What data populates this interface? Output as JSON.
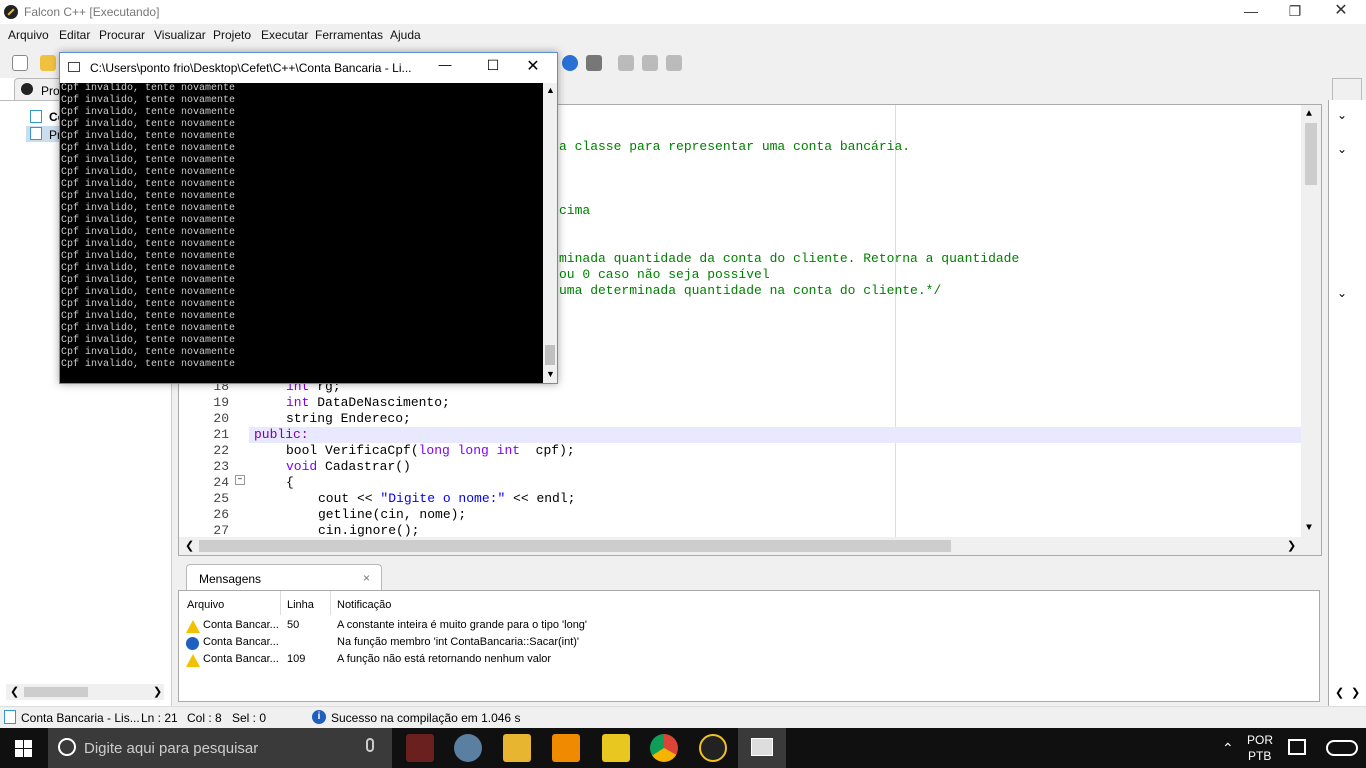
{
  "window": {
    "title": "Falcon C++ [Executando]"
  },
  "menu": [
    "Arquivo",
    "Editar",
    "Procurar",
    "Visualizar",
    "Projeto",
    "Executar",
    "Ferramentas",
    "Ajuda"
  ],
  "left_panel": {
    "tab_label": "Proj",
    "items": [
      "Co",
      "Pr"
    ]
  },
  "console": {
    "title": "C:\\Users\\ponto frio\\Desktop\\Cefet\\C++\\Conta Bancaria - Li...",
    "lines": [
      "Cpf invalido, tente novamente",
      "Cpf invalido, tente novamente",
      "Cpf invalido, tente novamente",
      "Cpf invalido, tente novamente",
      "Cpf invalido, tente novamente",
      "Cpf invalido, tente novamente",
      "Cpf invalido, tente novamente",
      "Cpf invalido, tente novamente",
      "Cpf invalido, tente novamente",
      "Cpf invalido, tente novamente",
      "Cpf invalido, tente novamente",
      "Cpf invalido, tente novamente",
      "Cpf invalido, tente novamente",
      "Cpf invalido, tente novamente",
      "Cpf invalido, tente novamente",
      "Cpf invalido, tente novamente",
      "Cpf invalido, tente novamente",
      "Cpf invalido, tente novamente",
      "Cpf invalido, tente novamente",
      "Cpf invalido, tente novamente",
      "Cpf invalido, tente novamente",
      "Cpf invalido, tente novamente",
      "Cpf invalido, tente novamente",
      "Cpf invalido, tente novamente"
    ]
  },
  "editor": {
    "comment_fragments": [
      "a classe para representar uma conta bancária.",
      "cima",
      "minada quantidade da conta do cliente. Retorna a quantidade",
      "ou 0 caso não seja possível",
      "uma determinada quantidade na conta do cliente.*/"
    ],
    "lines": [
      {
        "n": "18",
        "parts": [
          [
            "ty",
            "int"
          ],
          [
            "",
            "rg;"
          ]
        ]
      },
      {
        "n": "19",
        "parts": [
          [
            "ty",
            "int"
          ],
          [
            "",
            "DataDeNascimento;"
          ]
        ]
      },
      {
        "n": "20",
        "parts": [
          [
            "",
            "string Endereco;"
          ]
        ]
      },
      {
        "n": "21",
        "parts": [
          [
            "kw",
            "public:"
          ]
        ]
      },
      {
        "n": "22",
        "parts": [
          [
            "",
            "bool VerificaCpf("
          ],
          [
            "ty",
            "long long int"
          ],
          [
            "",
            " cpf);"
          ]
        ]
      },
      {
        "n": "23",
        "parts": [
          [
            "ty",
            "void"
          ],
          [
            "",
            "Cadastrar()"
          ]
        ]
      },
      {
        "n": "24",
        "parts": [
          [
            "",
            "{"
          ]
        ]
      },
      {
        "n": "25",
        "parts": [
          [
            "",
            "cout << "
          ],
          [
            "str",
            "\"Digite o nome:\""
          ],
          [
            "",
            " << endl;"
          ]
        ]
      },
      {
        "n": "26",
        "parts": [
          [
            "",
            "getline(cin, nome);"
          ]
        ]
      },
      {
        "n": "27",
        "parts": [
          [
            "",
            "cin.ignore();"
          ]
        ]
      }
    ]
  },
  "messages": {
    "tab_label": "Mensagens",
    "headers": [
      "Arquivo",
      "Linha",
      "Notificação"
    ],
    "rows": [
      {
        "icon": "warning-icon",
        "file": "Conta Bancar...",
        "line": "50",
        "note": "A constante inteira é muito grande para o tipo 'long'"
      },
      {
        "icon": "info-icon",
        "file": "Conta Bancar...",
        "line": "",
        "note": "Na função membro 'int ContaBancaria::Sacar(int)'"
      },
      {
        "icon": "warning-icon",
        "file": "Conta Bancar...",
        "line": "109",
        "note": "A função não está retornando nenhum valor"
      }
    ]
  },
  "status": {
    "file": "Conta Bancaria - Lis...",
    "ln": "Ln : 21",
    "col": "Col : 8",
    "sel": "Sel : 0",
    "compile": "Sucesso na compilação em 1.046 s"
  },
  "taskbar": {
    "search_placeholder": "Digite aqui para pesquisar",
    "lang1": "POR",
    "lang2": "PTB"
  }
}
